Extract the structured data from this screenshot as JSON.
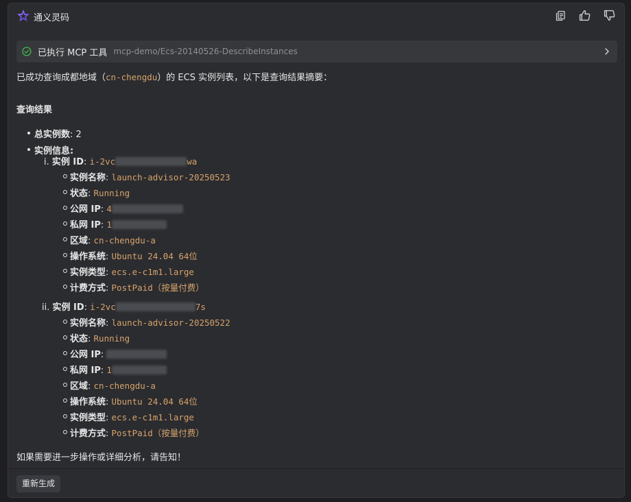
{
  "header": {
    "app_title": "通义灵码"
  },
  "mcp": {
    "label": "已执行 MCP 工具",
    "path": "mcp-demo/Ecs-20140526-DescribeInstances"
  },
  "intro": {
    "prefix": "已成功查询成都地域（",
    "region_code": "cn-chengdu",
    "suffix": "）的 ECS 实例列表，以下是查询结果摘要："
  },
  "result_heading": "查询结果",
  "summary": {
    "total_label": "总实例数",
    "total_value": "2",
    "info_label": "实例信息:"
  },
  "instances": [
    {
      "marker": "i.",
      "id_label": "实例 ID",
      "id_prefix": "i-2vc",
      "id_suffix": "wa",
      "fields": [
        {
          "label": "实例名称",
          "value": "launch-advisor-20250523"
        },
        {
          "label": "状态",
          "value": "Running"
        },
        {
          "label": "公网 IP",
          "value": "4"
        },
        {
          "label": "私网 IP",
          "value": "1"
        },
        {
          "label": "区域",
          "value": "cn-chengdu-a"
        },
        {
          "label": "操作系统",
          "value": "Ubuntu 24.04 64位"
        },
        {
          "label": "实例类型",
          "value": "ecs.e-c1m1.large"
        },
        {
          "label": "计费方式",
          "value": "PostPaid（按量付费）"
        }
      ]
    },
    {
      "marker": "ii.",
      "id_label": "实例 ID",
      "id_prefix": "i-2vc",
      "id_suffix": "7s",
      "fields": [
        {
          "label": "实例名称",
          "value": "launch-advisor-20250522"
        },
        {
          "label": "状态",
          "value": "Running"
        },
        {
          "label": "公网 IP",
          "value": ""
        },
        {
          "label": "私网 IP",
          "value": "1"
        },
        {
          "label": "区域",
          "value": "cn-chengdu-a"
        },
        {
          "label": "操作系统",
          "value": "Ubuntu 24.04 64位"
        },
        {
          "label": "实例类型",
          "value": "ecs.e-c1m1.large"
        },
        {
          "label": "计费方式",
          "value": "PostPaid（按量付费）"
        }
      ]
    }
  ],
  "closing": "如果需要进一步操作或详细分析，请告知！",
  "footer": {
    "regenerate_label": "重新生成"
  },
  "icons": {
    "logo": "tongyi-lingma-logo-icon",
    "copy": "copy-icon",
    "like": "thumbs-up-icon",
    "dislike": "thumbs-down-icon",
    "success": "check-circle-icon",
    "expand": "chevron-right-icon"
  },
  "colors": {
    "accent_logo": "#7b5cf5",
    "code_text": "#d6a36a",
    "success": "#3fb950"
  }
}
